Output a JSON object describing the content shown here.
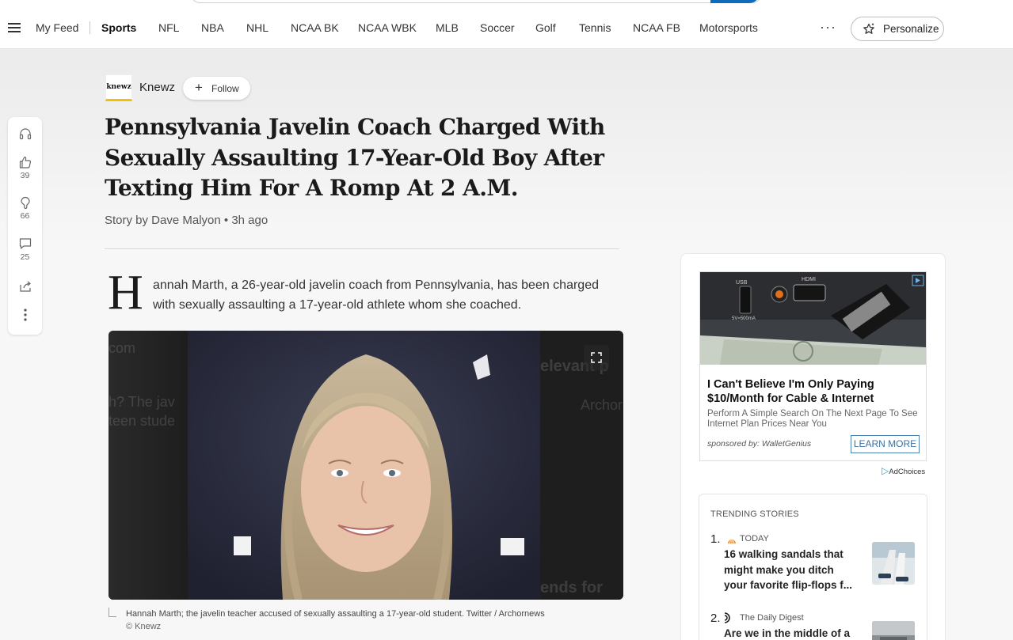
{
  "nav": {
    "items": [
      "My Feed",
      "Sports",
      "NFL",
      "NBA",
      "NHL",
      "NCAA BK",
      "NCAA WBK",
      "MLB",
      "Soccer",
      "Golf",
      "Tennis",
      "NCAA FB",
      "Motorsports"
    ],
    "active": "Sports",
    "more": "···",
    "personalize_label": "Personalize"
  },
  "publisher": {
    "logo_text": "knewz",
    "name": "Knewz",
    "follow_label": "Follow"
  },
  "engagement": {
    "likes": "39",
    "dislikes": "66",
    "comments": "25"
  },
  "article": {
    "headline": "Pennsylvania Javelin Coach Charged With Sexually Assaulting 17-Year-Old Boy After Texting Him For A Romp At 2 A.M.",
    "byline": "Story by Dave Malyon • 3h ago",
    "dropcap": "H",
    "lead": "annah Marth, a 26-year-old javelin coach from Pennsylvania, has been charged with sexually assaulting a 17-year-old athlete whom she coached.",
    "caption": "Hannah Marth; the javelin teacher accused of sexually assaulting a 17-year-old student. Twitter / Archornews",
    "credit": "© Knewz"
  },
  "ad": {
    "title": "I Can't Believe I'm Only Paying $10/Month for Cable & Internet",
    "description": "Perform A Simple Search On The Next Page To See Internet Plan Prices Near You",
    "sponsor": "sponsored by: WalletGenius",
    "cta": "LEARN MORE",
    "adchoices": "AdChoices"
  },
  "trending": {
    "heading": "TRENDING STORIES",
    "items": [
      {
        "num": "1.",
        "source": "TODAY",
        "title": "16 walking sandals that might make you ditch your favorite flip-flops f..."
      },
      {
        "num": "2.",
        "source": "The Daily Digest",
        "title": "Are we in the middle of a"
      }
    ]
  },
  "colors": {
    "accent": "#0f6cbd",
    "ad_cta": "#3b6fa0"
  }
}
